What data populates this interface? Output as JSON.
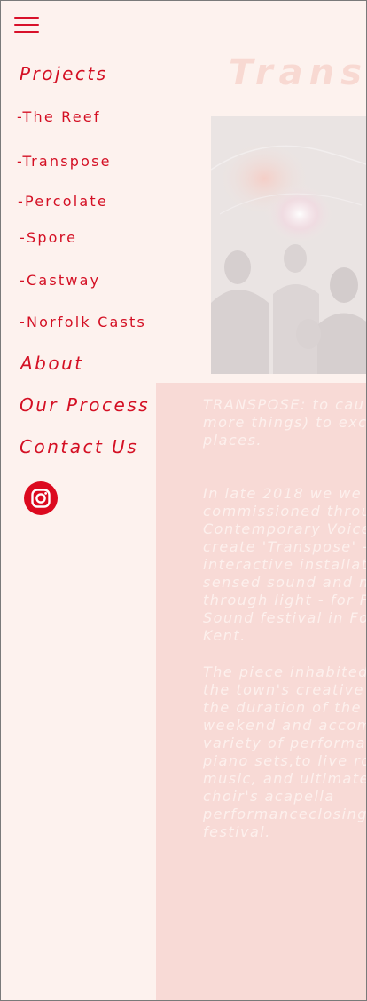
{
  "background_page": {
    "title": "Transp",
    "paragraphs": [
      [
        "TRANSPOSE: to cau",
        "more things) to exc",
        "places."
      ],
      [
        "In late 2018 we we",
        "commissioned throu",
        "Contemporary Voice",
        "create 'Transpose' -",
        "interactive installati",
        "sensed sound and m",
        "through light - for F",
        "Sound festival in Fo",
        "Kent."
      ],
      [
        "The piece inhabited",
        "the town's creative",
        "the duration of the",
        "weekend and accom",
        "variety of performar",
        "piano sets,to live ro",
        "music, and ultimate",
        "choir's acapella",
        "performanceclosing",
        "festival."
      ]
    ]
  },
  "menu": {
    "toggle_icon": "hamburger-menu-icon",
    "projects_label": "Projects",
    "projects": [
      {
        "label": "-The Reef"
      },
      {
        "label": "-Transpose"
      },
      {
        "label": "-Percolate"
      },
      {
        "label": "-Spore"
      },
      {
        "label": "-Castway"
      },
      {
        "label": "-Norfolk Casts"
      }
    ],
    "about_label": "About",
    "process_label": "Our Process",
    "contact_label": "Contact Us",
    "social_icon": "instagram-icon"
  },
  "colors": {
    "accent": "#d41024",
    "background": "#fdf2ee",
    "panel": "#f8dad6"
  }
}
